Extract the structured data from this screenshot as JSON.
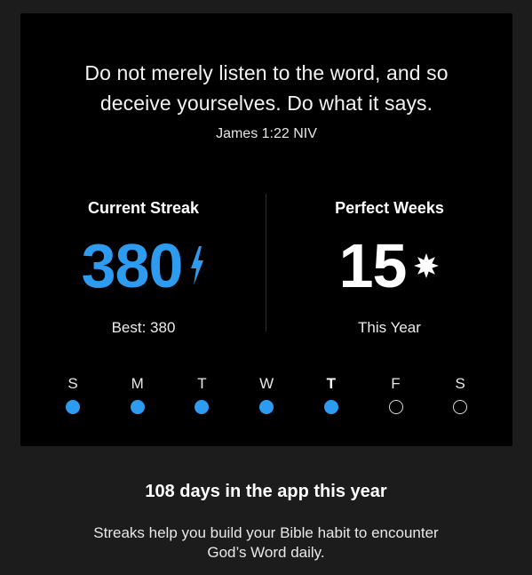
{
  "verse": {
    "line1": "Do not merely listen to the word, and so",
    "line2": "deceive yourselves. Do what it says.",
    "reference": "James 1:22 NIV"
  },
  "current_streak": {
    "title": "Current Streak",
    "value": "380",
    "icon": "lightning-bolt-icon",
    "sub": "Best: 380"
  },
  "perfect_weeks": {
    "title": "Perfect Weeks",
    "value": "15",
    "icon": "star-burst-icon",
    "sub": "This Year"
  },
  "week": {
    "days": [
      {
        "label": "S",
        "completed": true,
        "today": false
      },
      {
        "label": "M",
        "completed": true,
        "today": false
      },
      {
        "label": "T",
        "completed": true,
        "today": false
      },
      {
        "label": "W",
        "completed": true,
        "today": false
      },
      {
        "label": "T",
        "completed": true,
        "today": true
      },
      {
        "label": "F",
        "completed": false,
        "today": false
      },
      {
        "label": "S",
        "completed": false,
        "today": false
      }
    ]
  },
  "summary": {
    "headline": "108 days in the app this year",
    "line1": "Streaks help you build your Bible habit to encounter",
    "line2": "God’s Word daily."
  },
  "colors": {
    "accent": "#2d9cf0",
    "card_background": "#000000",
    "page_background": "#1c1c1c"
  }
}
